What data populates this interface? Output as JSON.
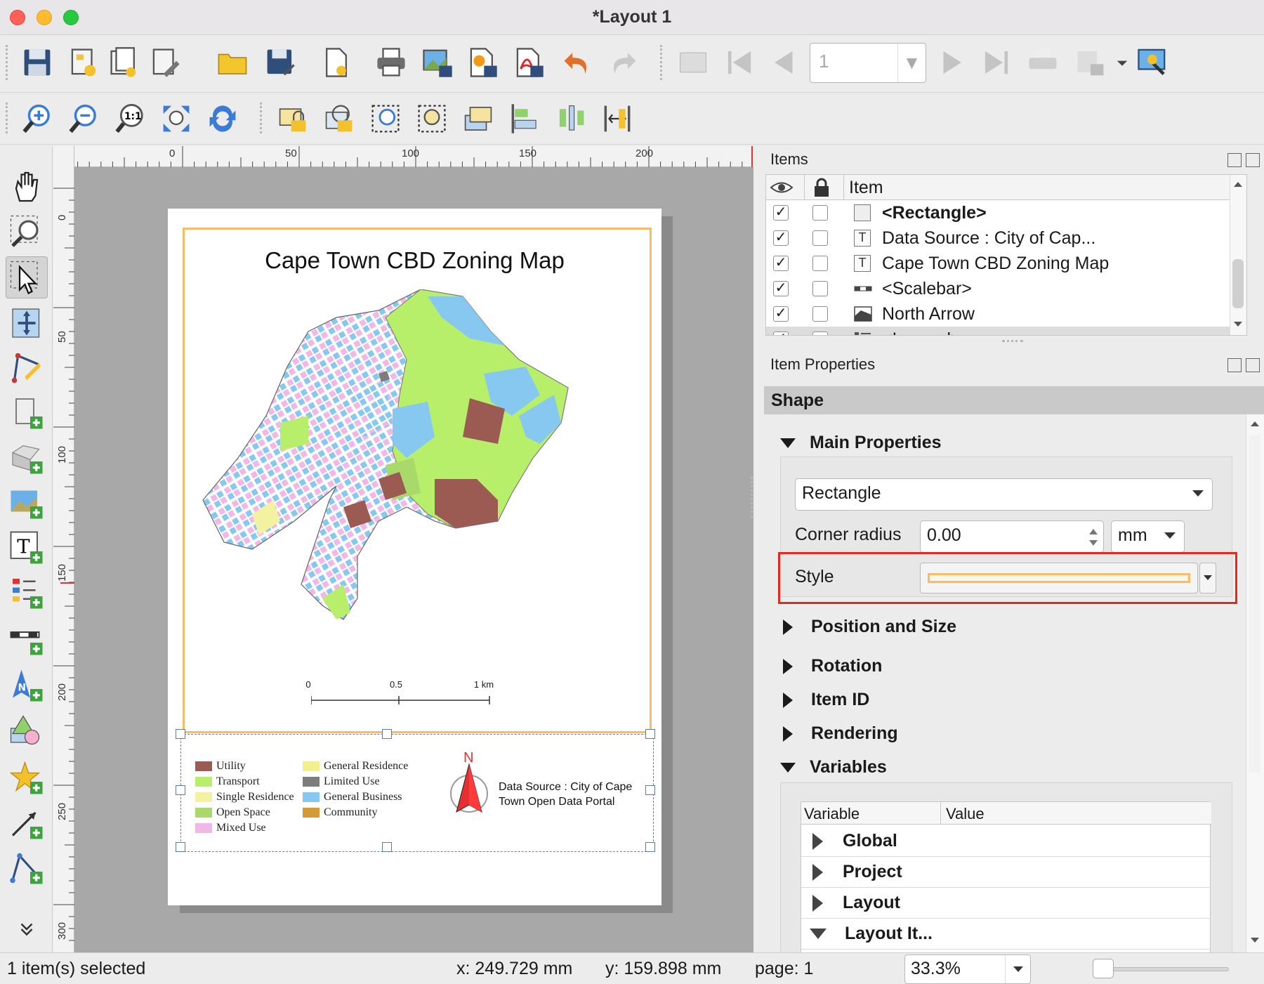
{
  "window": {
    "title": "*Layout 1"
  },
  "toolbar_top": {
    "icons": [
      "save-icon",
      "new-layout-icon",
      "duplicate-layout-icon",
      "layout-manager-icon",
      "open-folder-icon",
      "save-as-template-icon",
      "new-from-template-icon",
      "print-icon",
      "export-image-icon",
      "export-svg-icon",
      "export-pdf-icon",
      "undo-icon",
      "redo-icon"
    ],
    "atlas": {
      "page_value": "1"
    }
  },
  "toolbar_second": {
    "icons": [
      "zoom-in-icon",
      "zoom-out-icon",
      "zoom-actual-icon",
      "zoom-full-icon",
      "refresh-icon",
      "lock-items-icon",
      "unlock-items-icon",
      "select-all-icon",
      "deselect-icon",
      "raise-items-icon",
      "align-left-icon",
      "distribute-icon",
      "resize-icon"
    ]
  },
  "canvas": {
    "ruler_h": [
      "0",
      "50",
      "100",
      "150",
      "200"
    ],
    "ruler_v": [
      "0",
      "50",
      "100",
      "150",
      "200",
      "250",
      "300"
    ],
    "map_title": "Cape Town CBD Zoning Map",
    "scalebar": {
      "labels": [
        "0",
        "0.5",
        "1 km"
      ]
    },
    "legend": [
      {
        "label": "Utility",
        "color": "#9b5a52"
      },
      {
        "label": "Transport",
        "color": "#b8ef6a"
      },
      {
        "label": "Single Residence",
        "color": "#f2f2a0"
      },
      {
        "label": "Open Space",
        "color": "#a8d96a"
      },
      {
        "label": "Mixed Use",
        "color": "#f2b7e9"
      },
      {
        "label": "General Residence",
        "color": "#f0f08c"
      },
      {
        "label": "Limited Use",
        "color": "#7c7c7c"
      },
      {
        "label": "General Business",
        "color": "#86c8f0"
      },
      {
        "label": "Community",
        "color": "#d49a38"
      }
    ],
    "north_letter": "N",
    "data_source": "Data Source : City of Cape Town Open Data Portal"
  },
  "items_panel": {
    "title": "Items",
    "column_item": "Item",
    "rows": [
      {
        "label": "<Rectangle>",
        "icon": "rectangle-icon",
        "visible": "✓",
        "bold": true
      },
      {
        "label": "Data Source : City of Cap...",
        "icon": "text-icon",
        "visible": "✓",
        "bold": false
      },
      {
        "label": "Cape Town CBD Zoning Map",
        "icon": "text-icon",
        "visible": "✓",
        "bold": false
      },
      {
        "label": "<Scalebar>",
        "icon": "scalebar-icon",
        "visible": "✓",
        "bold": false
      },
      {
        "label": "North Arrow",
        "icon": "picture-icon",
        "visible": "✓",
        "bold": false
      },
      {
        "label": "<Legend>",
        "icon": "legend-icon",
        "visible": "✓",
        "bold": false
      }
    ],
    "text_glyph": "T"
  },
  "properties_panel": {
    "title": "Item Properties",
    "shape_header": "Shape",
    "main_properties": "Main Properties",
    "shape_type": "Rectangle",
    "corner_radius_label": "Corner radius",
    "corner_radius_value": "0.00",
    "corner_unit": "mm",
    "style_label": "Style",
    "style_color": "#f7bb6a",
    "sections": [
      "Position and Size",
      "Rotation",
      "Item ID",
      "Rendering"
    ],
    "variables_label": "Variables",
    "variables_table": {
      "col_variable": "Variable",
      "col_value": "Value",
      "rows": [
        "Global",
        "Project",
        "Layout",
        "Layout It..."
      ]
    }
  },
  "statusbar": {
    "selection": "1 item(s) selected",
    "x": "x: 249.729 mm",
    "y": "y: 159.898 mm",
    "page": "page: 1",
    "zoom": "33.3%"
  }
}
